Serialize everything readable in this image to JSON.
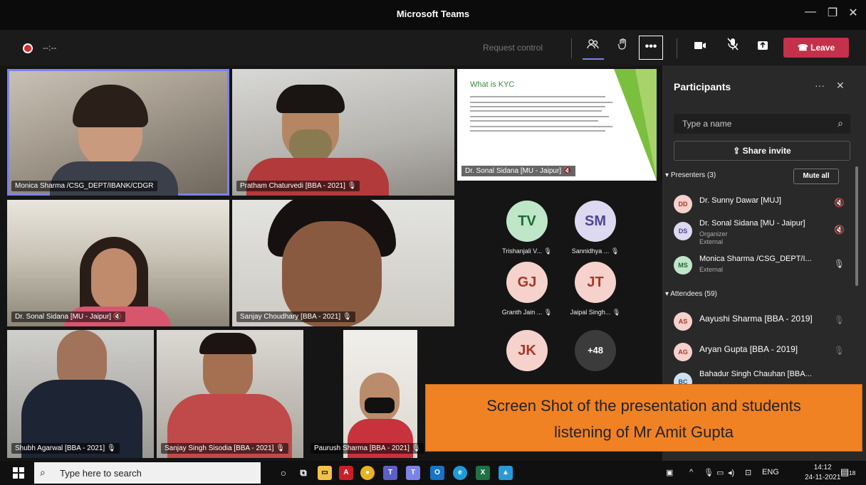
{
  "window": {
    "title": "Microsoft Teams",
    "minimize": "—",
    "maximize": "❐",
    "close": "✕"
  },
  "toolbar": {
    "recording_time": "--:--",
    "request_control": "Request control",
    "participants_icon": "people-icon",
    "raise_hand_icon": "hand-icon",
    "more": "•••",
    "camera_icon": "camera-icon",
    "mic_icon": "mic-off-icon",
    "share_icon": "share-tray-icon",
    "leave": "Leave"
  },
  "videos": [
    {
      "name": "Monica Sharma /CSG_DEPT/IBANK/CDGR",
      "selected": true
    },
    {
      "name": "Pratham Chaturvedi [BBA - 2021]",
      "mic": "🎙"
    },
    {
      "name": "Dr. Sonal Sidana [MU - Jaipur]",
      "mic": "🔇"
    },
    {
      "name": "Sanjay Choudhary [BBA - 2021]",
      "mic": "🎙"
    },
    {
      "name": "Shubh Agarwal [BBA - 2021]",
      "mic": "🎙"
    },
    {
      "name": "Sanjay Singh Sisodia [BBA - 2021]",
      "mic": "🎙"
    },
    {
      "name": "Paurush Sharma [BBA - 2021]",
      "mic": "🎙"
    }
  ],
  "slide": {
    "title": "What is KYC",
    "presenter": "Dr. Sonal Sidana [MU - Jaipur]"
  },
  "avatars": [
    {
      "initials": "TV",
      "label": "Trishanjali V...",
      "bg": "#bfe6c9",
      "fg": "#1d6a36"
    },
    {
      "initials": "SM",
      "label": "Sannidhya ...",
      "bg": "#dcd9f0",
      "fg": "#4b4696"
    },
    {
      "initials": "GJ",
      "label": "Granth Jain ...",
      "bg": "#f6d2cc",
      "fg": "#a43a2a"
    },
    {
      "initials": "JT",
      "label": "Jaipal Singh...",
      "bg": "#f6d2cc",
      "fg": "#a43a2a"
    },
    {
      "initials": "JK",
      "label": "",
      "bg": "#f6d2cc",
      "fg": "#a43a2a"
    },
    {
      "initials": "+48",
      "label": "",
      "bg": "#3b3b3b",
      "fg": "#ffffff"
    }
  ],
  "panel": {
    "title": "Participants",
    "more": "···",
    "close": "✕",
    "search_placeholder": "Type a name",
    "share_invite": "Share invite",
    "presenters_label": "Presenters (3)",
    "mute_all": "Mute all",
    "attendees_label": "Attendees (59)",
    "presenters": [
      {
        "initials": "DD",
        "name": "Dr. Sunny Dawar [MUJ]",
        "sub1": "",
        "sub2": "",
        "bg": "#f6d2cc",
        "fg": "#a43a2a"
      },
      {
        "initials": "DS",
        "name": "Dr. Sonal Sidana [MU - Jaipur]",
        "sub1": "Organizer",
        "sub2": "External",
        "bg": "#dcd9f0",
        "fg": "#4b4696"
      },
      {
        "initials": "MS",
        "name": "Monica Sharma /CSG_DEPT/I...",
        "sub1": "External",
        "sub2": "",
        "bg": "#bfe6c9",
        "fg": "#1d6a36"
      }
    ],
    "attendees": [
      {
        "initials": "AS",
        "name": "Aayushi Sharma [BBA - 2019]",
        "bg": "#f6d2cc",
        "fg": "#a43a2a"
      },
      {
        "initials": "AG",
        "name": "Aryan Gupta [BBA - 2019]",
        "bg": "#f6d2cc",
        "fg": "#a43a2a"
      },
      {
        "initials": "BC",
        "name": "Bahadur Singh Chauhan [BBA...",
        "bg": "#cfe0f3",
        "fg": "#2a5a8a"
      }
    ]
  },
  "banner": {
    "line1": "Screen Shot of the presentation and students",
    "line2": "listening of Mr Amit Gupta"
  },
  "taskbar": {
    "search_placeholder": "Type here to search",
    "lang": "ENG",
    "time": "14:12",
    "date": "24-11-2021",
    "notifications": "18"
  }
}
